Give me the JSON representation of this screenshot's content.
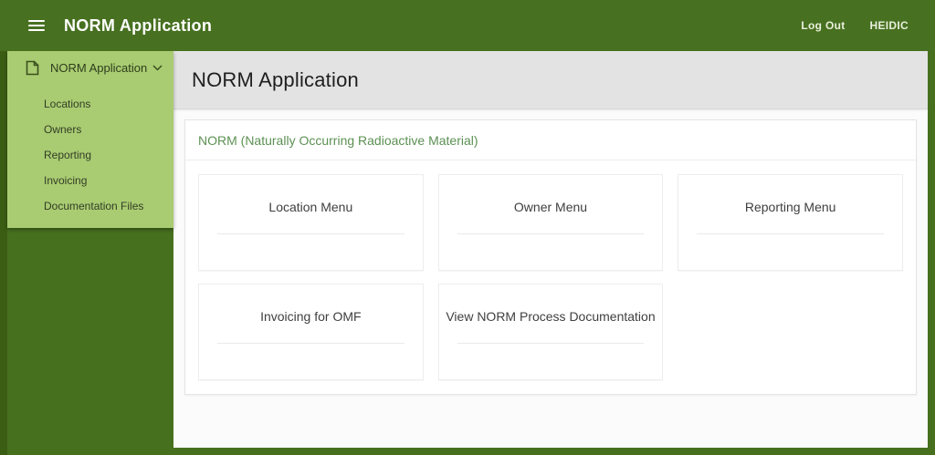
{
  "header": {
    "title": "NORM Application",
    "logout_label": "Log Out",
    "username": "HEIDIC"
  },
  "sidebar": {
    "title": "NORM Application",
    "items": [
      {
        "label": "Locations"
      },
      {
        "label": "Owners"
      },
      {
        "label": "Reporting"
      },
      {
        "label": "Invoicing"
      },
      {
        "label": "Documentation Files"
      }
    ]
  },
  "main": {
    "page_title": "NORM Application",
    "region": {
      "title": "NORM (Naturally Occurring Radioactive Material)"
    },
    "cards": [
      {
        "label": "Location Menu"
      },
      {
        "label": "Owner Menu"
      },
      {
        "label": "Reporting Menu"
      },
      {
        "label": "Invoicing for OMF"
      },
      {
        "label": "View NORM Process Documentation"
      }
    ]
  },
  "icons": {
    "hamburger": "three-bar menu glyph",
    "document": "page outline with folded corner",
    "chevron_down": "v-shaped expand arrow"
  },
  "colors": {
    "header_green": "#477020",
    "frame_green": "#46701e",
    "left_strip_green": "#3b5d13",
    "sidebar_green": "#a9cc72",
    "page_header_gray": "#e3e3e3",
    "accent_text_green": "#5c9053"
  }
}
